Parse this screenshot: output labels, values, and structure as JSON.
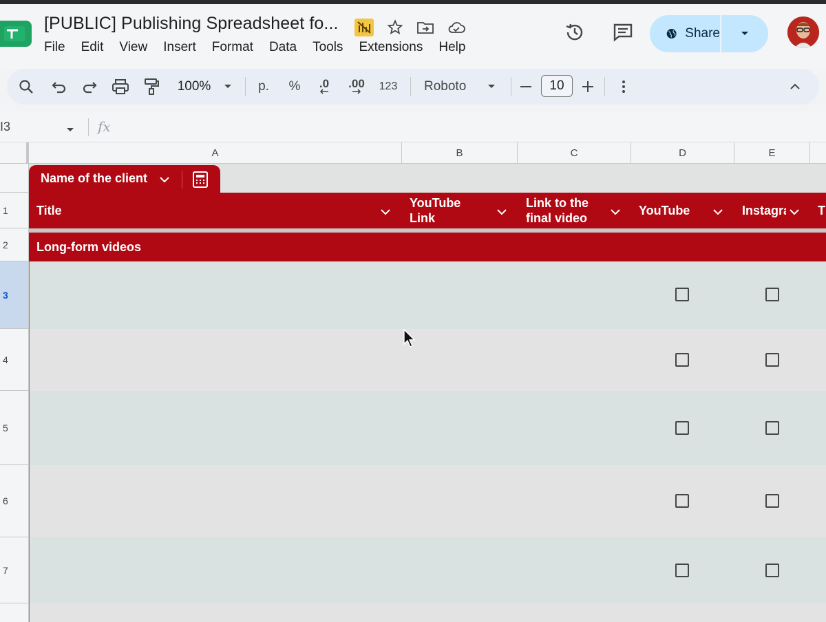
{
  "header": {
    "title": "[PUBLIC] Publishing Spreadsheet fo...",
    "menu": [
      "File",
      "Edit",
      "View",
      "Insert",
      "Format",
      "Data",
      "Tools",
      "Extensions",
      "Help"
    ],
    "share_label": "Share"
  },
  "toolbar": {
    "zoom": "100%",
    "currency": "p.",
    "percent": "%",
    "decrease_decimal": ".0",
    "increase_decimal": ".00",
    "number_format": "123",
    "font": "Roboto",
    "font_size": "10"
  },
  "formula_bar": {
    "cell_ref": "I3",
    "fx": "fx"
  },
  "columns": [
    "A",
    "B",
    "C",
    "D",
    "E"
  ],
  "rows": [
    "1",
    "2",
    "3",
    "4",
    "5",
    "6",
    "7"
  ],
  "table": {
    "name": "Name of the client",
    "headers": {
      "title": "Title",
      "youtube_link_1": "YouTube",
      "youtube_link_2": "Link",
      "final_video_1": "Link to the",
      "final_video_2": "final video",
      "youtube": "YouTube",
      "instagram": "Instagra",
      "next": "T"
    },
    "group_label": "Long-form videos"
  },
  "colors": {
    "table_red": "#b10913",
    "share_bg": "#c2e7ff",
    "row_band": "#d9e2e0"
  }
}
